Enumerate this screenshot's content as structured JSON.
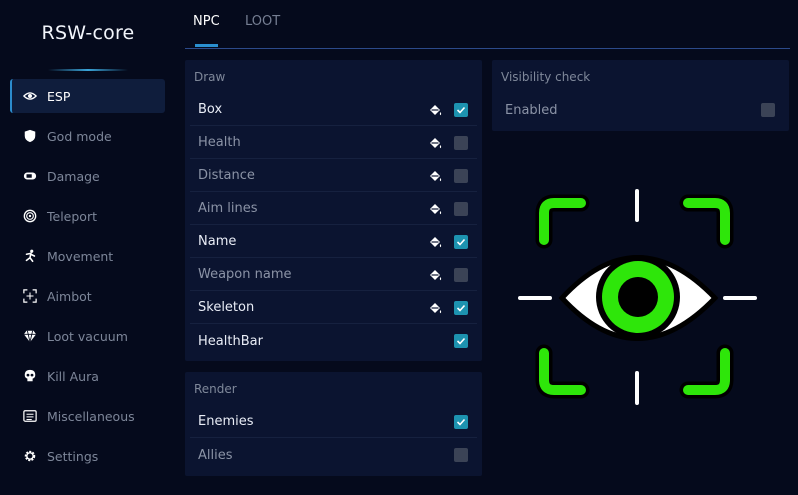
{
  "app": {
    "title": "RSW-core"
  },
  "sidebar": {
    "items": [
      {
        "label": "ESP",
        "icon": "eye-icon",
        "active": true
      },
      {
        "label": "God mode",
        "icon": "shield-icon"
      },
      {
        "label": "Damage",
        "icon": "bullet-icon"
      },
      {
        "label": "Teleport",
        "icon": "portal-icon"
      },
      {
        "label": "Movement",
        "icon": "running-icon"
      },
      {
        "label": "Aimbot",
        "icon": "crosshair-icon"
      },
      {
        "label": "Loot vacuum",
        "icon": "gem-icon"
      },
      {
        "label": "Kill Aura",
        "icon": "skull-icon"
      },
      {
        "label": "Miscellaneous",
        "icon": "list-icon"
      },
      {
        "label": "Settings",
        "icon": "gear-icon"
      }
    ]
  },
  "tabs": [
    {
      "label": "NPC",
      "active": true
    },
    {
      "label": "LOOT",
      "active": false
    }
  ],
  "draw": {
    "title": "Draw",
    "items": [
      {
        "label": "Box",
        "checked": true,
        "color_picker": true
      },
      {
        "label": "Health",
        "checked": false,
        "color_picker": true
      },
      {
        "label": "Distance",
        "checked": false,
        "color_picker": true
      },
      {
        "label": "Aim lines",
        "checked": false,
        "color_picker": true
      },
      {
        "label": "Name",
        "checked": true,
        "color_picker": true
      },
      {
        "label": "Weapon name",
        "checked": false,
        "color_picker": true
      },
      {
        "label": "Skeleton",
        "checked": true,
        "color_picker": true
      },
      {
        "label": "HealthBar",
        "checked": true,
        "color_picker": false
      }
    ]
  },
  "render": {
    "title": "Render",
    "items": [
      {
        "label": "Enemies",
        "checked": true
      },
      {
        "label": "Allies",
        "checked": false
      }
    ]
  },
  "visibility": {
    "title": "Visibility check",
    "items": [
      {
        "label": "Enabled",
        "checked": false
      }
    ]
  },
  "colors": {
    "background": "#050a1c",
    "panel": "#0b1430",
    "accent": "#2a8fd0",
    "checkbox_on": "#1d93b0",
    "checkbox_off": "#3b4356",
    "preview_green": "#2ee60a"
  }
}
